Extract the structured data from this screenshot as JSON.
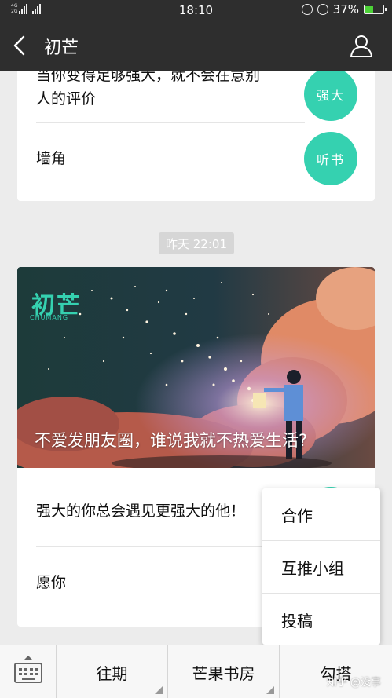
{
  "status_bar": {
    "network_left": "4G",
    "network_right": "2G",
    "time": "18:10",
    "battery": "37%"
  },
  "header": {
    "title": "初芒"
  },
  "list_top": [
    {
      "text_line1": "当你变得足够强大，就不会在意别",
      "text_line2": "人的评价",
      "badge": "强大",
      "badge_color": "#35d1b0"
    },
    {
      "text": "墙角",
      "badge": "听书",
      "badge_color": "#35d1b0"
    }
  ],
  "timestamp": "昨天 22:01",
  "article": {
    "hero_logo": "初芒",
    "hero_logo_sub": "CHUMANG",
    "headline": "不爱发朋友圈，谁说我就不热爱生活?",
    "items": [
      {
        "text": "强大的你总会遇见更强大的他！"
      },
      {
        "text": "愿你"
      }
    ]
  },
  "popup_menu": {
    "items": [
      "合作",
      "互推小组",
      "投稿"
    ]
  },
  "bottom_bar": {
    "menus": [
      "往期",
      "芒果书房",
      "勾搭"
    ]
  },
  "watermark": "知乎 @没事",
  "colors": {
    "accent": "#35d1b0",
    "bar_bg": "#2e2e2e",
    "page_bg": "#ececec"
  }
}
